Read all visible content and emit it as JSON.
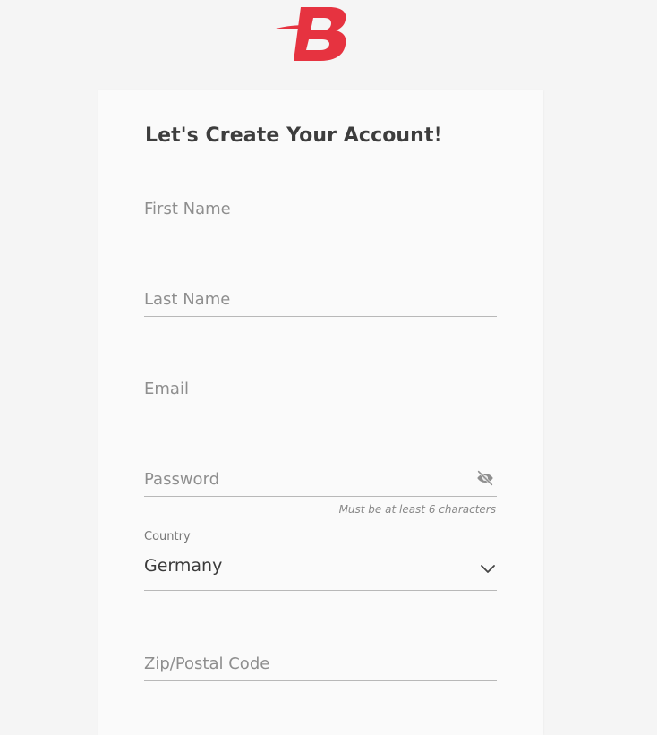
{
  "brand": {
    "logo_letter": "B",
    "accent": "#e63340"
  },
  "form": {
    "title": "Let's Create Your Account!",
    "first_name": {
      "placeholder": "First Name",
      "value": ""
    },
    "last_name": {
      "placeholder": "Last Name",
      "value": ""
    },
    "email": {
      "placeholder": "Email",
      "value": ""
    },
    "password": {
      "placeholder": "Password",
      "value": "",
      "helper": "Must be at least 6 characters",
      "toggle_icon": "eye-slash-icon"
    },
    "country": {
      "label": "Country",
      "value": "Germany",
      "icon": "chevron-down-icon"
    },
    "zip": {
      "placeholder": "Zip/Postal Code",
      "value": ""
    }
  }
}
